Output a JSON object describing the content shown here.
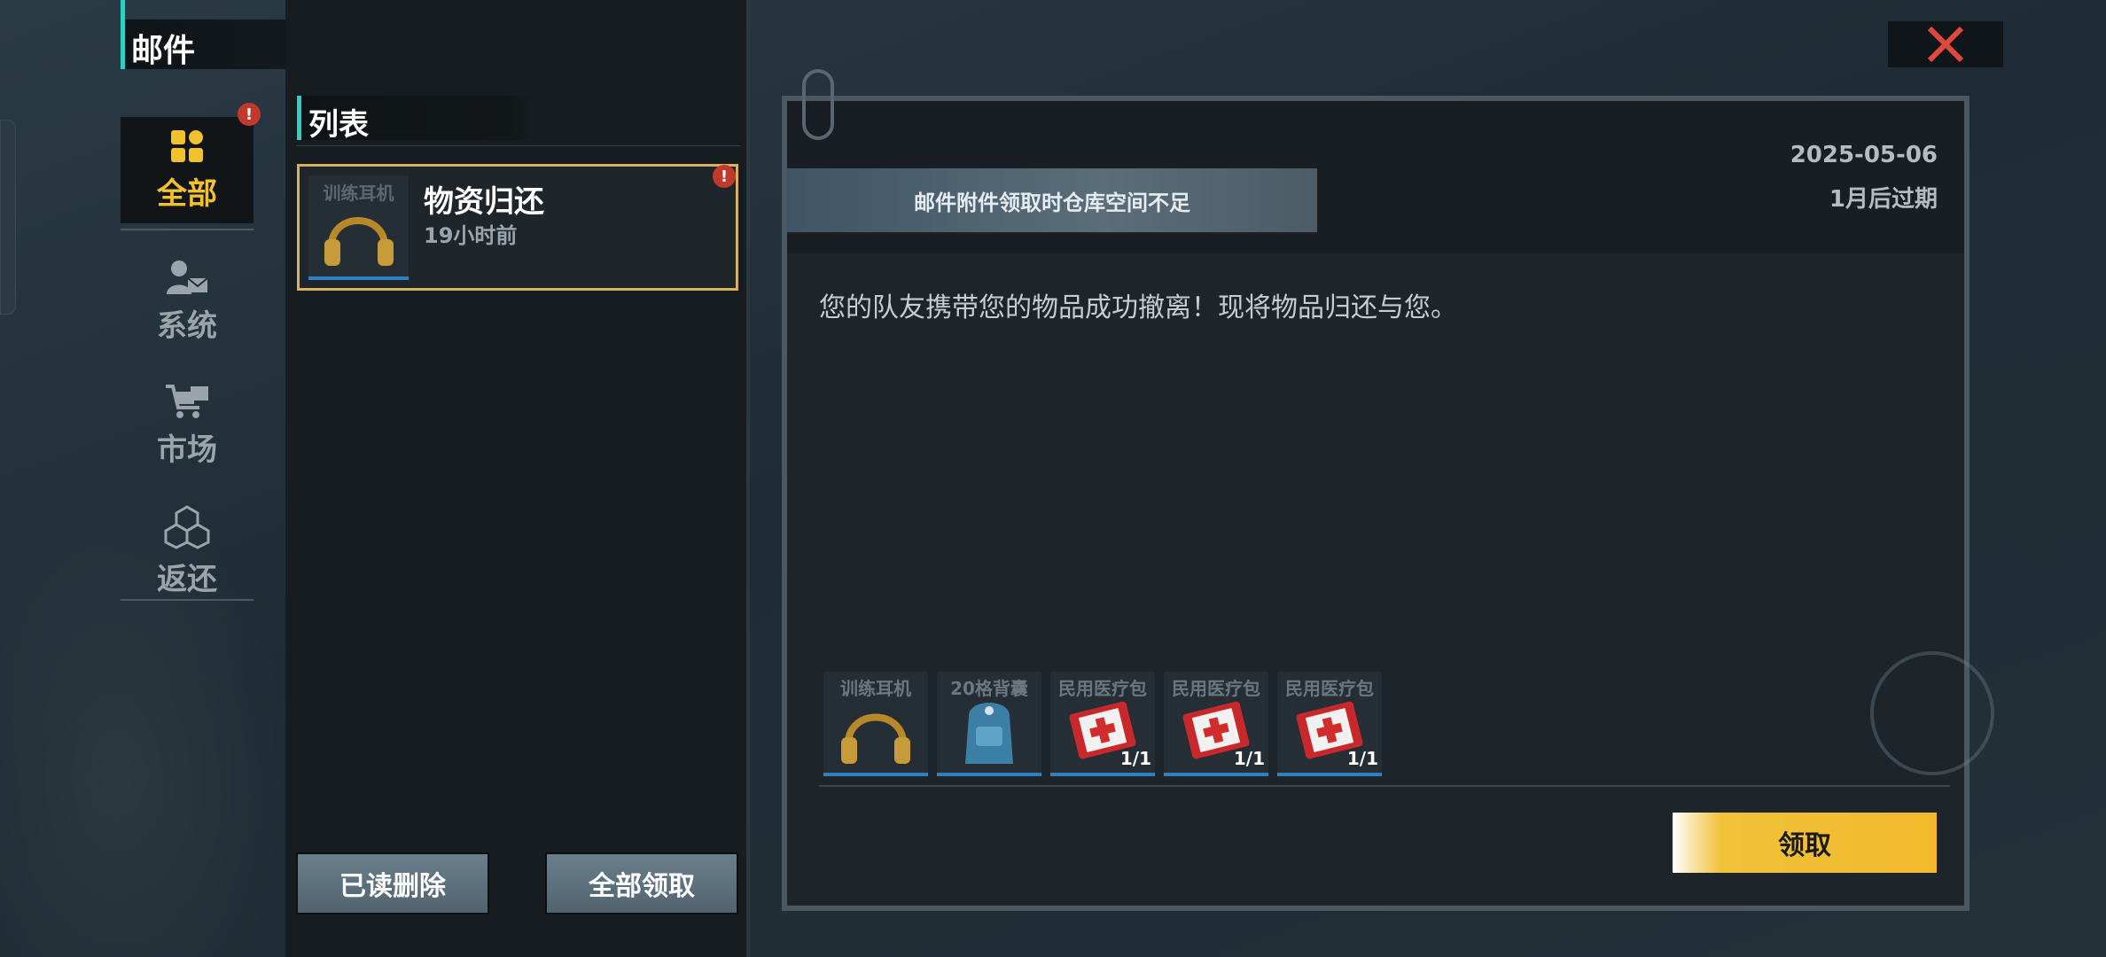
{
  "header": {
    "title": "邮件"
  },
  "categories": [
    {
      "label": "全部",
      "icon": "grid-icon",
      "active": true
    },
    {
      "label": "系统",
      "icon": "user-mail-icon",
      "active": false
    },
    {
      "label": "市场",
      "icon": "cart-icon",
      "active": false
    },
    {
      "label": "返还",
      "icon": "cubes-icon",
      "active": false
    }
  ],
  "category_badge": "!",
  "list": {
    "heading": "列表",
    "items": [
      {
        "thumb_caption": "训练耳机",
        "title": "物资归还",
        "time": "19小时前",
        "badge": "!"
      }
    ]
  },
  "footer": {
    "delete_read": "已读删除",
    "claim_all": "全部领取"
  },
  "detail": {
    "date": "2025-05-06",
    "expire": "1月后过期",
    "toast": "邮件附件领取时仓库空间不足",
    "body": "您的队友携带您的物品成功撤离！现将物品归还与您。",
    "attachments": [
      {
        "caption": "训练耳机",
        "icon": "headphones-icon",
        "qty": ""
      },
      {
        "caption": "20格背囊",
        "icon": "backpack-icon",
        "qty": ""
      },
      {
        "caption": "民用医疗包",
        "icon": "medkit-icon",
        "qty": "1/1"
      },
      {
        "caption": "民用医疗包",
        "icon": "medkit-icon",
        "qty": "1/1"
      },
      {
        "caption": "民用医疗包",
        "icon": "medkit-icon",
        "qty": "1/1"
      }
    ],
    "claim_label": "领取"
  },
  "colors": {
    "accent": "#2fd0c4",
    "active_gold": "#f2c12e",
    "claim_yellow": "#f2b92c",
    "badge_red": "#c0392b"
  }
}
